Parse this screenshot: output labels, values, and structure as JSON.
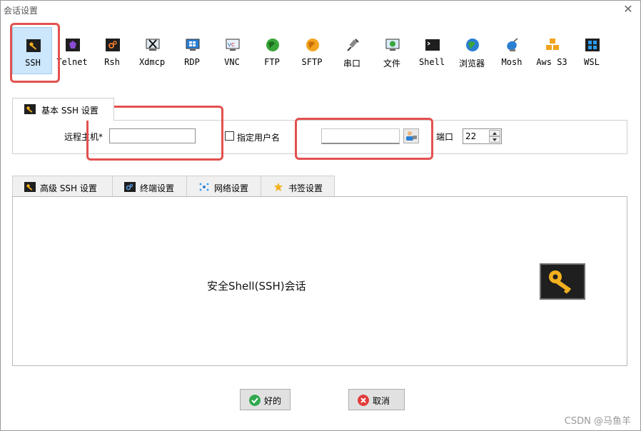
{
  "window": {
    "title": "会话设置",
    "close_symbol": "✕"
  },
  "protocols": [
    {
      "label": "SSH",
      "icon": "ssh-key-icon",
      "selected": true
    },
    {
      "label": "Telnet",
      "icon": "telnet-icon"
    },
    {
      "label": "Rsh",
      "icon": "rsh-icon"
    },
    {
      "label": "Xdmcp",
      "icon": "xdmcp-icon"
    },
    {
      "label": "RDP",
      "icon": "rdp-monitor-icon"
    },
    {
      "label": "VNC",
      "icon": "vnc-icon"
    },
    {
      "label": "FTP",
      "icon": "ftp-globe-icon"
    },
    {
      "label": "SFTP",
      "icon": "sftp-globe-icon"
    },
    {
      "label": "串口",
      "icon": "serial-plug-icon"
    },
    {
      "label": "文件",
      "icon": "file-monitor-icon"
    },
    {
      "label": "Shell",
      "icon": "shell-terminal-icon"
    },
    {
      "label": "浏览器",
      "icon": "browser-globe-icon"
    },
    {
      "label": "Mosh",
      "icon": "mosh-satellite-icon"
    },
    {
      "label": "Aws S3",
      "icon": "aws-cubes-icon"
    },
    {
      "label": "WSL",
      "icon": "wsl-windows-icon"
    }
  ],
  "basic": {
    "tab_label": "基本 SSH 设置",
    "host_label": "远程主机*",
    "host_value": "",
    "username_checkbox_label": "指定用户名",
    "username_value": "",
    "port_label": "端口",
    "port_value": "22"
  },
  "advanced_tabs": [
    {
      "label": "高级 SSH 设置",
      "icon": "key-icon"
    },
    {
      "label": "终端设置",
      "icon": "terminal-icon"
    },
    {
      "label": "网络设置",
      "icon": "network-icon"
    },
    {
      "label": "书签设置",
      "icon": "star-icon"
    }
  ],
  "panel": {
    "description": "安全Shell(SSH)会话"
  },
  "buttons": {
    "ok": "好的",
    "cancel": "取消"
  },
  "watermark": "CSDN @马鱼羊",
  "colors": {
    "highlight": "#e2514f",
    "selected_bg": "#cce6fb",
    "ok_green": "#2fa84f",
    "cancel_red": "#e23b3b",
    "key_gold": "#f2b01e"
  }
}
